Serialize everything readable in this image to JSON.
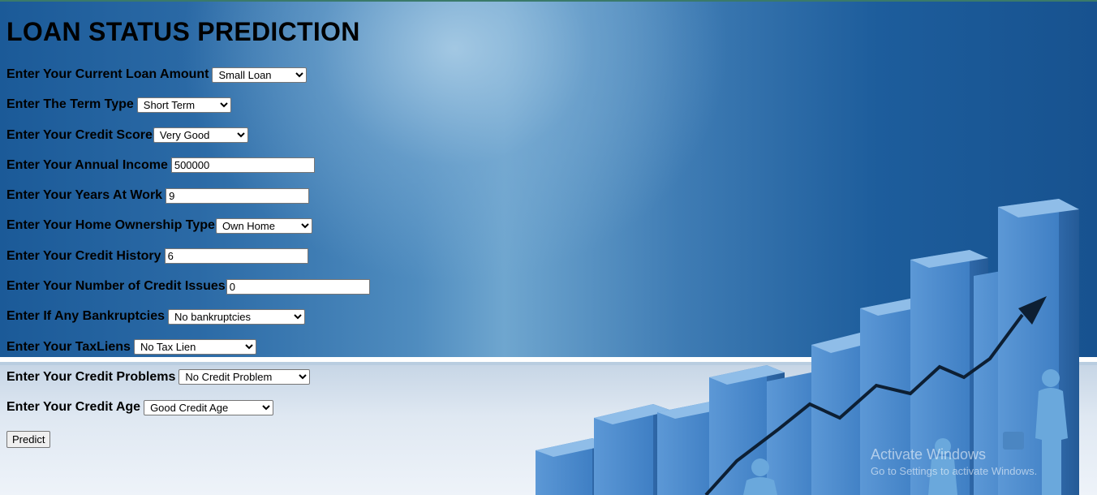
{
  "title": "LOAN STATUS PREDICTION",
  "fields": [
    {
      "label": "Enter Your Current Loan Amount",
      "type": "select",
      "value": "Small Loan",
      "width": 117
    },
    {
      "label": "Enter The Term Type",
      "type": "select",
      "value": "Short Term",
      "width": 116
    },
    {
      "label": "Enter Your Credit Score",
      "type": "select",
      "value": "Very Good",
      "width": 117
    },
    {
      "label": "Enter Your Annual Income",
      "type": "input",
      "value": "500000",
      "width": 177
    },
    {
      "label": "Enter Your Years At Work",
      "type": "input",
      "value": "9",
      "width": 177
    },
    {
      "label": "Enter Your Home Ownership Type",
      "type": "select",
      "value": "Own Home",
      "width": 119
    },
    {
      "label": "Enter Your Credit History",
      "type": "input",
      "value": "6",
      "width": 177
    },
    {
      "label": "Enter Your Number of Credit Issues",
      "type": "input",
      "value": "0",
      "width": 177
    },
    {
      "label": "Enter If Any Bankruptcies",
      "type": "select",
      "value": "No bankruptcies",
      "width": 169
    },
    {
      "label": "Enter Your TaxLiens",
      "type": "select",
      "value": "No Tax Lien",
      "width": 151
    },
    {
      "label": "Enter Your Credit Problems",
      "type": "select",
      "value": "No Credit Problem",
      "width": 162
    },
    {
      "label": "Enter Your Credit Age",
      "type": "select",
      "value": "Good Credit Age",
      "width": 160
    }
  ],
  "predict_label": "Predict",
  "watermark": {
    "line1": "Activate Windows",
    "line2": "Go to Settings to activate Windows."
  }
}
